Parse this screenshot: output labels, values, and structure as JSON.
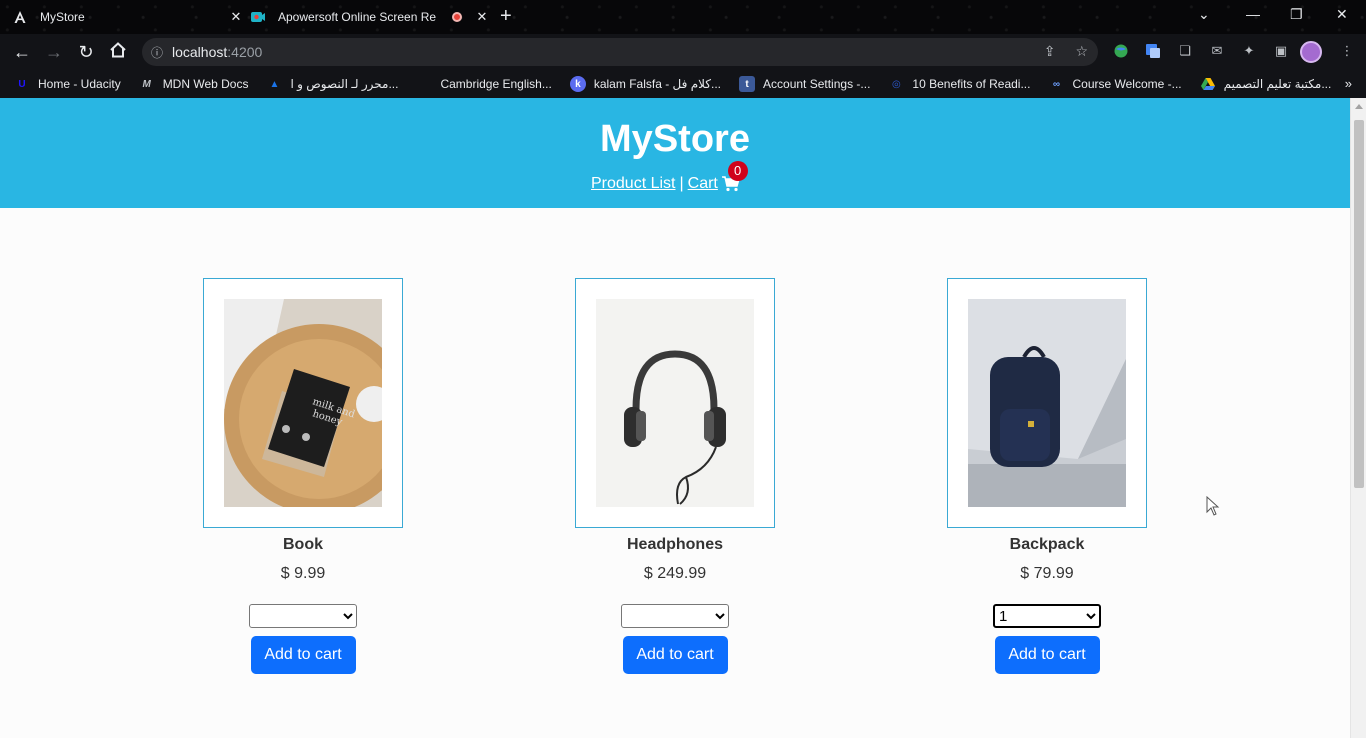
{
  "browser": {
    "tabs": [
      {
        "title": "MyStore",
        "icon": "angular-icon"
      },
      {
        "title": "Apowersoft Online Screen Re",
        "icon": "recorder-icon"
      }
    ],
    "url_host": "localhost",
    "url_port": ":4200",
    "bookmarks": [
      {
        "label": "Home - Udacity",
        "icon": "udacity-icon",
        "color": "#2015ff"
      },
      {
        "label": "MDN Web Docs",
        "icon": "mdn-icon",
        "color": "#333333"
      },
      {
        "label": "محرر لـ النصوص و ا...",
        "icon": "editor-icon",
        "color": "#1a73e8"
      },
      {
        "label": "Cambridge English...",
        "icon": "cambridge-icon",
        "color": "#121317"
      },
      {
        "label": "kalam Falsfa - كلام فل...",
        "icon": "kalam-icon",
        "color": "#5b6cf0"
      },
      {
        "label": "Account Settings -...",
        "icon": "account-icon",
        "color": "#3b5998"
      },
      {
        "label": "10 Benefits of Readi...",
        "icon": "benefits-icon",
        "color": "#2c5bd6"
      },
      {
        "label": "Course Welcome -...",
        "icon": "course-icon",
        "color": "#2a6df4"
      },
      {
        "label": "مكتبة تعليم التصميم...",
        "icon": "drive-icon",
        "color": "#fbbc04"
      }
    ]
  },
  "store": {
    "brand": "MyStore",
    "nav_product_list": "Product List",
    "nav_separator": "|",
    "nav_cart": "Cart",
    "cart_count": "0"
  },
  "products": [
    {
      "name": "Book",
      "price": "$ 9.99",
      "qty": "",
      "button": "Add to cart"
    },
    {
      "name": "Headphones",
      "price": "$ 249.99",
      "qty": "",
      "button": "Add to cart"
    },
    {
      "name": "Backpack",
      "price": "$ 79.99",
      "qty": "1",
      "button": "Add to cart"
    }
  ],
  "colors": {
    "header_bg": "#29b6e3",
    "button_bg": "#0d6efd",
    "badge_bg": "#d0021b"
  }
}
